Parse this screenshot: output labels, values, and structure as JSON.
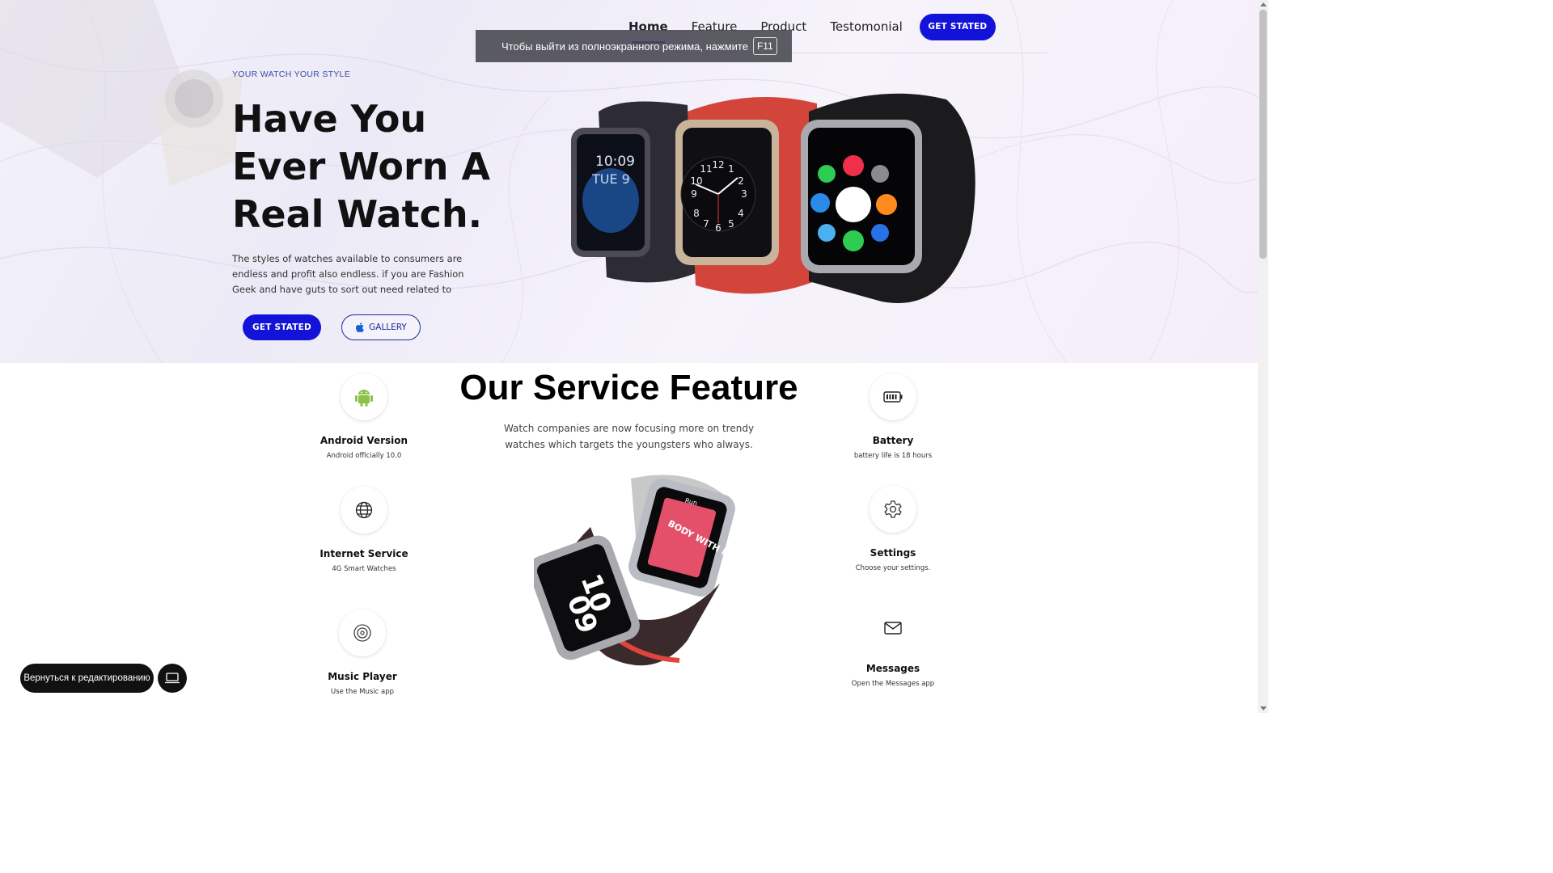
{
  "nav": {
    "items": [
      "Home",
      "Feature",
      "Product",
      "Testomonial"
    ],
    "active": "Home",
    "cta": "GET STATED"
  },
  "toast": {
    "text": "Чтобы выйти из полноэкранного режима, нажмите",
    "key": "F11"
  },
  "hero": {
    "eyebrow": "YOUR WATCH YOUR STYLE",
    "headline": [
      "Have You",
      "Ever Worn A",
      "Real Watch."
    ],
    "lead": "The styles of watches available to consumers are endless and profit also endless. if you are Fashion Geek and have guts to sort out need related to",
    "primary_button": "GET STATED",
    "secondary_button": "GALLERY",
    "watch_texts": {
      "time": "10:09",
      "date": "TUE 9"
    }
  },
  "features": {
    "title": "Our Service Feature",
    "subtitle": "Watch companies are now focusing more on trendy watches which targets the youngsters who always.",
    "left": [
      {
        "icon": "android-icon",
        "title": "Android Version",
        "desc": "Android officially 10.0"
      },
      {
        "icon": "globe-icon",
        "title": "Internet Service",
        "desc": "4G Smart Watches"
      },
      {
        "icon": "music-disc-icon",
        "title": "Music Player",
        "desc": "Use the Music app"
      }
    ],
    "right": [
      {
        "icon": "battery-icon",
        "title": "Battery",
        "desc": "battery life is 18 hours"
      },
      {
        "icon": "gear-icon",
        "title": "Settings",
        "desc": "Choose your settings."
      },
      {
        "icon": "mail-icon",
        "title": "Messages",
        "desc": "Open the Messages app"
      }
    ],
    "center_watch_texts": {
      "big_time_top": "10",
      "big_time_bottom": "09",
      "screen_title": "Run",
      "screen_banner": "BODY WITH MO"
    }
  },
  "editor": {
    "back_button": "Вернуться к редактированию"
  },
  "colors": {
    "primary": "#1212d9",
    "text": "#111111",
    "accent_link": "#3a4aaa"
  }
}
